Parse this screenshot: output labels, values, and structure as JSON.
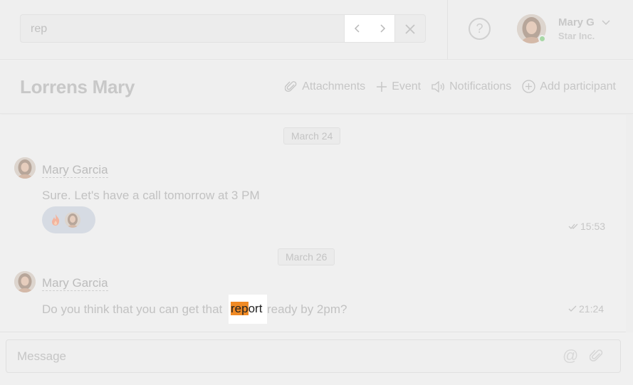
{
  "search": {
    "value": "rep",
    "prev_icon": "chevron-left-icon",
    "next_icon": "chevron-right-icon",
    "close_icon": "close-icon"
  },
  "header": {
    "help_icon": "question-circle-icon",
    "user": {
      "name": "Mary G",
      "org": "Star Inc.",
      "status": "online"
    }
  },
  "chat": {
    "title": "Lorrens Mary",
    "actions": {
      "attachments": "Attachments",
      "event": "Event",
      "notifications": "Notifications",
      "add_participant": "Add participant"
    }
  },
  "messages": {
    "groups": [
      {
        "date": "March 24",
        "author": "Mary Garcia",
        "text": "Sure. Let's have a call tomorrow at 3 PM",
        "time": "15:53",
        "reaction": "fire",
        "read": "double-check"
      },
      {
        "date": "March 26",
        "author": "Mary Garcia",
        "text_before": "Do you think that you can get that",
        "highlight_match": "rep",
        "highlight_rest": "ort",
        "text_after": "ready by 2pm?",
        "time": "21:24",
        "read": "single-check"
      }
    ]
  },
  "composer": {
    "placeholder": "Message",
    "mention_icon": "at-icon",
    "attach_icon": "paperclip-icon"
  },
  "colors": {
    "highlight": "#f08a24",
    "online": "#a8d8a6",
    "reaction_bg": "#d6dbe3"
  }
}
